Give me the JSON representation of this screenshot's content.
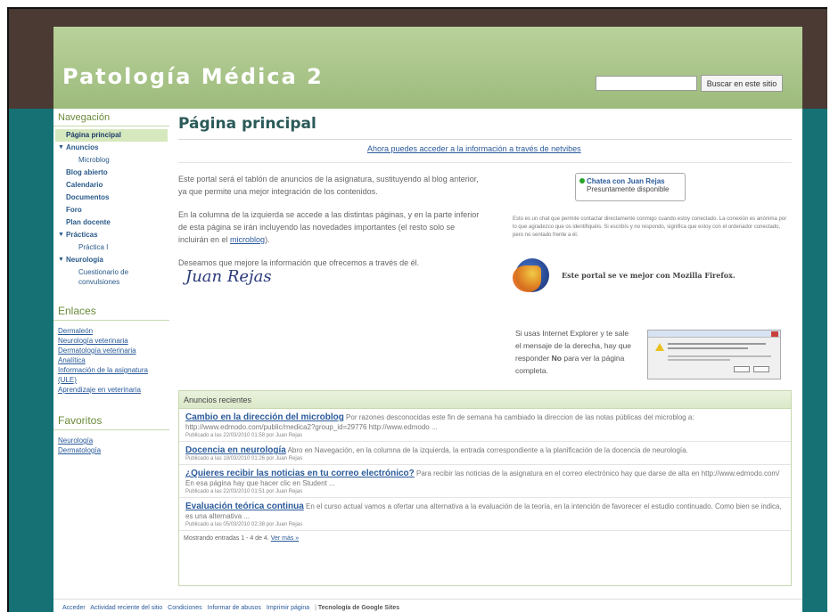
{
  "site": {
    "title": "Patología Médica 2",
    "search_button": "Buscar en este sitio",
    "search_value": ""
  },
  "sidebar": {
    "nav_heading": "Navegación",
    "nav": {
      "home": "Página principal",
      "anuncios": "Anuncios",
      "microblog": "Microblog",
      "blog": "Blog abierto",
      "calendario": "Calendario",
      "documentos": "Documentos",
      "foro": "Foro",
      "plan": "Plan docente",
      "practicas": "Prácticas",
      "practica1": "Práctica I",
      "neurologia": "Neurología",
      "cuestionario": "Cuestionario de convulsiones"
    },
    "links_heading": "Enlaces",
    "links": [
      "Dermaleón",
      "Neurología veterinaria",
      "Dermatología veterinaria",
      "Analítica",
      "Información de la asignatura (ULE)",
      "Aprendizaje en veterinaria"
    ],
    "fav_heading": "Favoritos",
    "favorites": [
      "Neurología",
      "Dermatología"
    ]
  },
  "main": {
    "title": "Página principal",
    "netvibes_link": "Ahora puedes acceder a la información a través de netvibes",
    "intro": [
      "Este portal será el tablón de anuncios de la asignatura, sustituyendo al blog anterior, ya que permite una mejor integración de los contenidos.",
      "En la columna de la izquierda se accede a las distintas páginas, y en la parte inferior de esta página se irán incluyendo las novedades importantes (el resto solo se incluirán en el ",
      "microblog",
      ").",
      "Deseamos que mejore la información que ofrecemos a través de él."
    ],
    "signature": "Juan Rejas",
    "chat_name": "Chatea con Juan Rejas",
    "chat_status": "Presuntamente disponible",
    "chat_desc": "Esto es un chat que permite contactar directamente conmigo cuando estoy conectado. La conexión es anónima por lo que agradezco que os identifiquéis. Si escribís y no respondo, significa que estoy con el ordenador conectado, pero no sentado frente a él.",
    "firefox_text": "Este portal se ve mejor con Mozilla Firefox.",
    "ie_text_1": "Si usas Internet Explorer y te sale el mensaje de la derecha, hay que responder ",
    "ie_text_bold": "No",
    "ie_text_2": " para ver la página completa."
  },
  "announcements": {
    "heading": "Anuncios recientes",
    "posts": [
      {
        "title": "Cambio en la dirección del microblog",
        "text": "Por razones desconocidas este fin de semana ha cambiado la direccion de las notas públicas del microblog a: http://www.edmodo.com/public/medica2?group_id=29776 http://www.edmodo ...",
        "meta": "Publicado a las 22/03/2010 01:58 por Juan Rejas"
      },
      {
        "title": "Docencia en neurología",
        "text": "Abro en Navegación, en la columna de la izquierda, la entrada correspondiente a la planificación de la docencia de neurología.",
        "meta": "Publicado a las 18/03/2010 01:26 por Juan Rejas"
      },
      {
        "title": "¿Quieres recibir las noticias en tu correo electrónico?",
        "text": "Para recibir las noticias de la asignatura en el correo electrónico hay que darse de alta en http://www.edmodo.com/ En esa página hay que hacer clic en Student ...",
        "meta": "Publicado a las 22/03/2010 01:51 por Juan Rejas"
      },
      {
        "title": "Evaluación teórica continua",
        "text": "En el curso actual vamos a ofertar una alternativa a la evaluación de la teoría, en la intención de favorecer el estudio continuado. Como bien se indica, es una alternativa ...",
        "meta": "Publicado a las 05/03/2010 02:38 por Juan Rejas"
      }
    ],
    "footer_text": "Mostrando entradas 1 - 4 de 4.",
    "more_link": "Ver más »"
  },
  "footer": {
    "links": [
      "Acceder",
      "Actividad reciente del sitio",
      "Condiciones",
      "Informar de abusos",
      "Imprimir página"
    ],
    "separator": "|",
    "powered": "Tecnología de Google Sites"
  },
  "colors": {
    "header_green": "#9dbb7c",
    "dark_brown": "#4a3a33",
    "teal": "#157174",
    "link_blue": "#2a5a9a"
  }
}
